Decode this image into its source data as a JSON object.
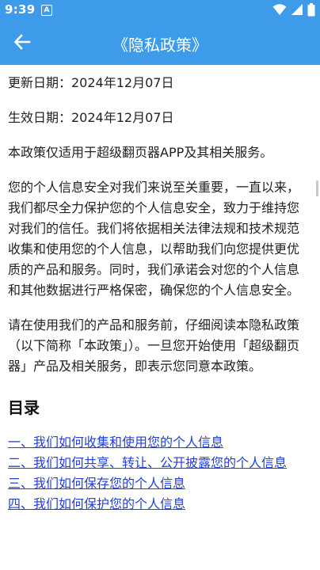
{
  "status_bar": {
    "time": "9:39",
    "notification_icon": "A",
    "icons": [
      "wifi-icon",
      "signal-icon",
      "battery-icon"
    ],
    "background": "#3d9be9"
  },
  "app_bar": {
    "title": "《隐私政策》",
    "back_icon": "arrow-left-icon",
    "background": "#3d9be9"
  },
  "content": {
    "update_date": "更新日期：2024年12月07日",
    "effective_date": "生效日期：2024年12月07日",
    "scope": "本政策仅适用于超级翻页器APP及其相关服务。",
    "importance": "您的个人信息安全对我们来说至关重要，一直以来，我们都尽全力保护您的个人信息安全，致力于维持您对我们的信任。我们将依据相关法律法规和技术规范收集和使用您的个人信息，以帮助我们向您提供更优质的产品和服务。同时，我们承诺会对您的个人信息和其他数据进行严格保密，确保您的个人信息安全。",
    "notice": "请在使用我们的产品和服务前，仔细阅读本隐私政策（以下简称「本政策」）。一旦您开始使用「超级翻页器」产品及相关服务，即表示您同意本政策。",
    "toc_heading": "目录",
    "toc": [
      "一、我们如何收集和使用您的个人信息",
      "二、我们如何共享、转让、公开披露您的个人信息",
      "三、我们如何保存您的个人信息",
      "四、我们如何保护您的个人信息"
    ],
    "link_color": "#2440d6"
  }
}
